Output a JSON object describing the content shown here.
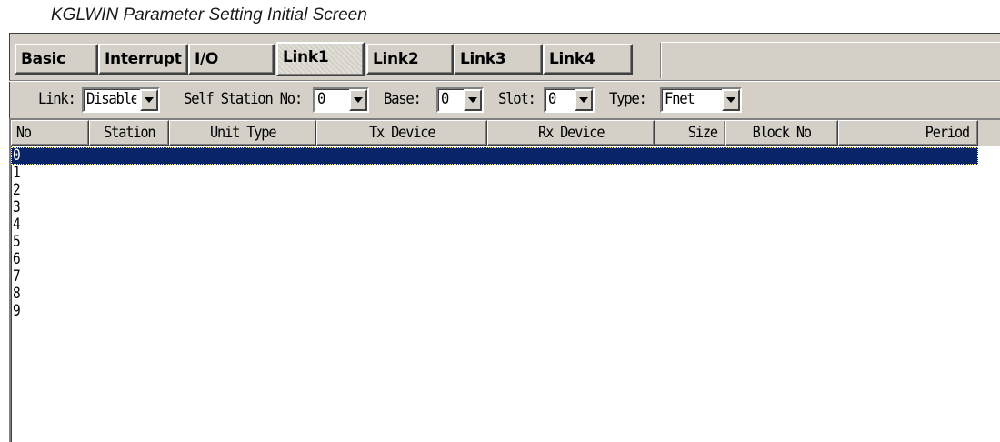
{
  "caption": "KGLWIN Parameter Setting Initial Screen",
  "tabs": [
    {
      "label": "Basic"
    },
    {
      "label": "Interrupt"
    },
    {
      "label": "I/O"
    },
    {
      "label": "Link1"
    },
    {
      "label": "Link2"
    },
    {
      "label": "Link3"
    },
    {
      "label": "Link4"
    }
  ],
  "active_tab": "Link1",
  "options": {
    "link_label": "Link:",
    "link_value": "Disable",
    "station_label": "Self Station No:",
    "station_value": "0",
    "base_label": "Base:",
    "base_value": "0",
    "slot_label": "Slot:",
    "slot_value": "0",
    "type_label": "Type:",
    "type_value": "Fnet"
  },
  "grid": {
    "columns": [
      "No",
      "Station",
      "Unit Type",
      "Tx Device",
      "Rx Device",
      "Size",
      "Block No",
      "Period"
    ],
    "rows": [
      "0",
      "1",
      "2",
      "3",
      "4",
      "5",
      "6",
      "7",
      "8",
      "9"
    ],
    "selected_row": "0"
  },
  "colors": {
    "window_face": "#d4d0c8",
    "selection": "#0a246a"
  }
}
